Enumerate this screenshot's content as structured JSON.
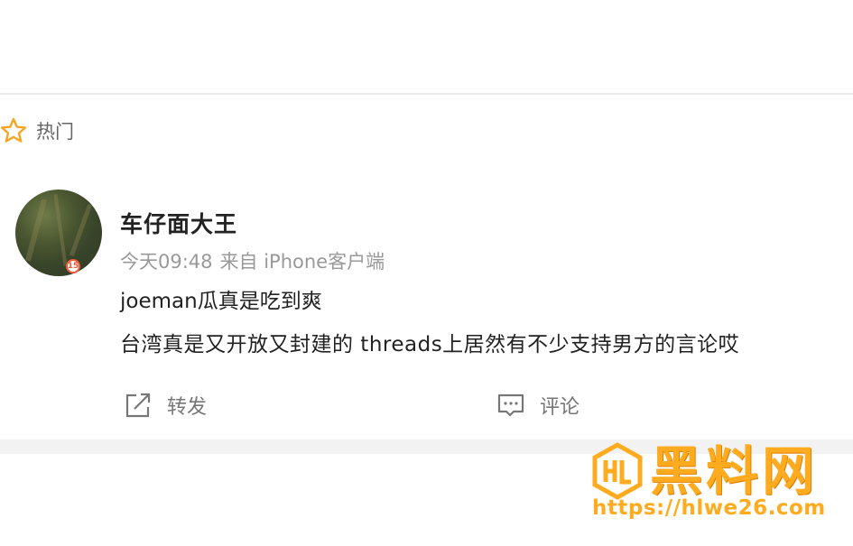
{
  "section": {
    "label": "热门",
    "icon": "star-icon"
  },
  "post": {
    "username": "车仔面大王",
    "avatar_badge": "15",
    "time": "今天09:48",
    "source": "来自 iPhone客户端",
    "line1": "joeman瓜真是吃到爽",
    "line2": "台湾真是又开放又封建的 threads上居然有不少支持男方的言论哎"
  },
  "actions": {
    "repost_label": "转发",
    "comment_label": "评论"
  },
  "watermark": {
    "title": "黑料网",
    "url": "https://hlwe26.com"
  },
  "colors": {
    "accent_star": "#f5a623",
    "watermark": "#ffab1f",
    "text_primary": "#222222",
    "text_secondary": "#999999"
  }
}
